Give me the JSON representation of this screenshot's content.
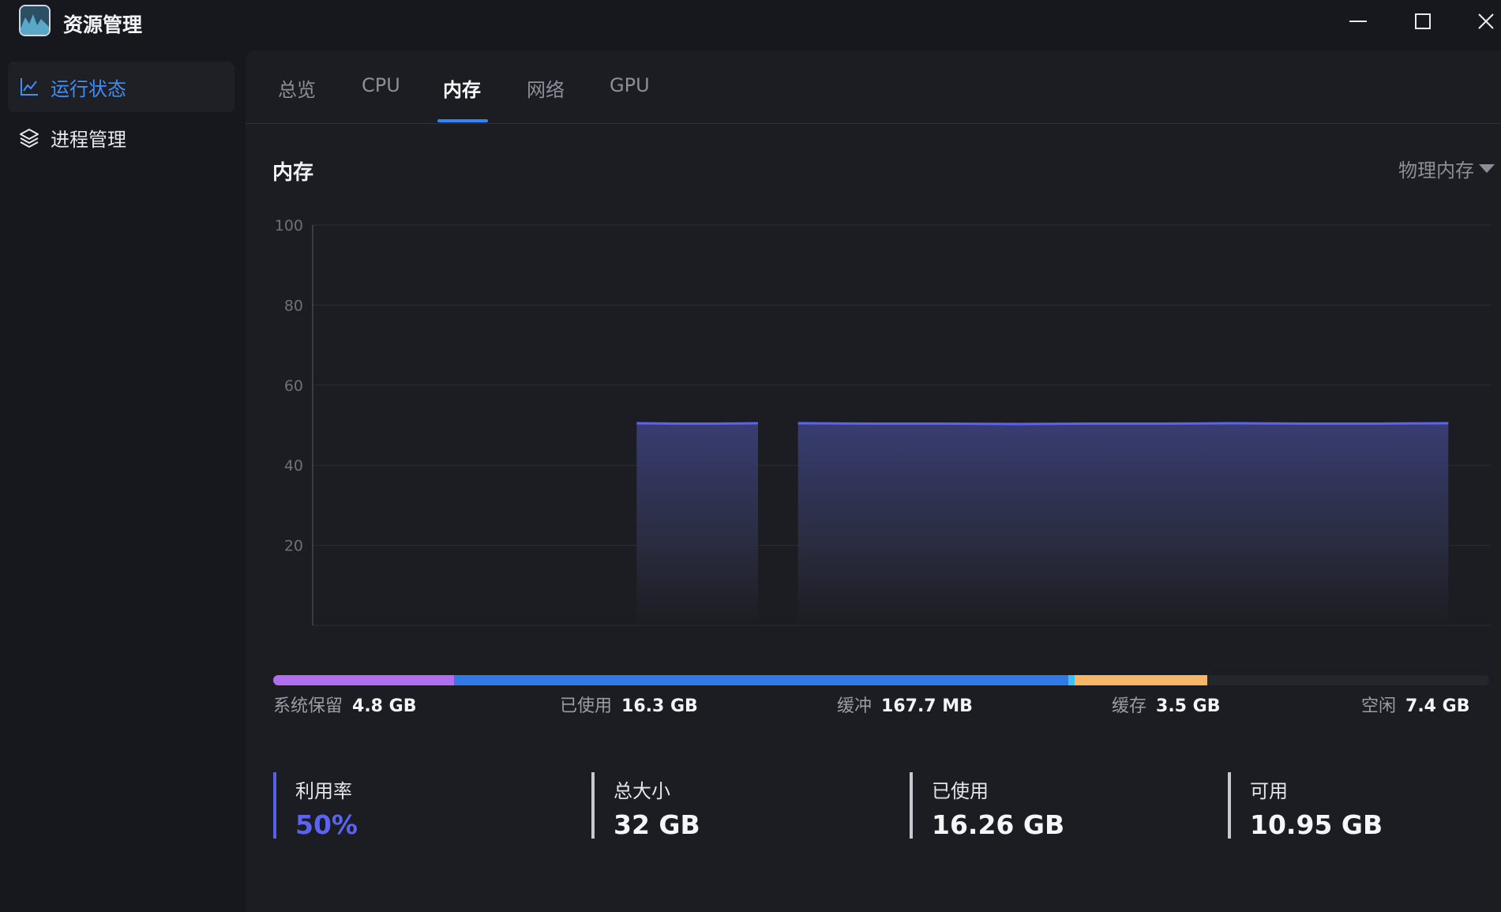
{
  "app": {
    "title": "资源管理"
  },
  "sidebar": {
    "items": [
      {
        "label": "运行状态",
        "icon": "line-chart-icon",
        "active": true
      },
      {
        "label": "进程管理",
        "icon": "layers-icon",
        "active": false
      }
    ]
  },
  "tabs": [
    {
      "label": "总览"
    },
    {
      "label": "CPU"
    },
    {
      "label": "内存",
      "active": true
    },
    {
      "label": "网络"
    },
    {
      "label": "GPU"
    }
  ],
  "section": {
    "title": "内存",
    "dropdown_value": "物理内存"
  },
  "chart_data": {
    "type": "area",
    "y_ticks": [
      "100",
      "80",
      "60",
      "40",
      "20"
    ],
    "ylim": [
      0,
      100
    ],
    "grid": true,
    "line_color": "#5a63f2",
    "segments": [
      {
        "x_start": 0.275,
        "x_end": 0.378,
        "values": [
          50.5,
          50.4,
          50.4,
          50.5
        ]
      },
      {
        "x_start": 0.412,
        "x_end": 0.964,
        "values": [
          50.5,
          50.4,
          50.4,
          50.3,
          50.4,
          50.4,
          50.5,
          50.4,
          50.4,
          50.5
        ]
      }
    ]
  },
  "memory_breakdown": [
    {
      "label": "系统保留",
      "value": "4.8 GB",
      "color": "#b36ef0",
      "fraction": 0.149
    },
    {
      "label": "已使用",
      "value": "16.3 GB",
      "color": "#2f7ae6",
      "fraction": 0.505
    },
    {
      "label": "缓冲",
      "value": "167.7 MB",
      "color": "#3dc1f2",
      "fraction": 0.005
    },
    {
      "label": "缓存",
      "value": "3.5 GB",
      "color": "#f7b766",
      "fraction": 0.109
    },
    {
      "label": "空闲",
      "value": "7.4 GB",
      "color": "#24262e",
      "fraction": 0.232
    }
  ],
  "stats": [
    {
      "label": "利用率",
      "value": "50%",
      "accent": true
    },
    {
      "label": "总大小",
      "value": "32 GB",
      "accent": false
    },
    {
      "label": "已使用",
      "value": "16.26 GB",
      "accent": false
    },
    {
      "label": "可用",
      "value": "10.95 GB",
      "accent": false
    }
  ]
}
